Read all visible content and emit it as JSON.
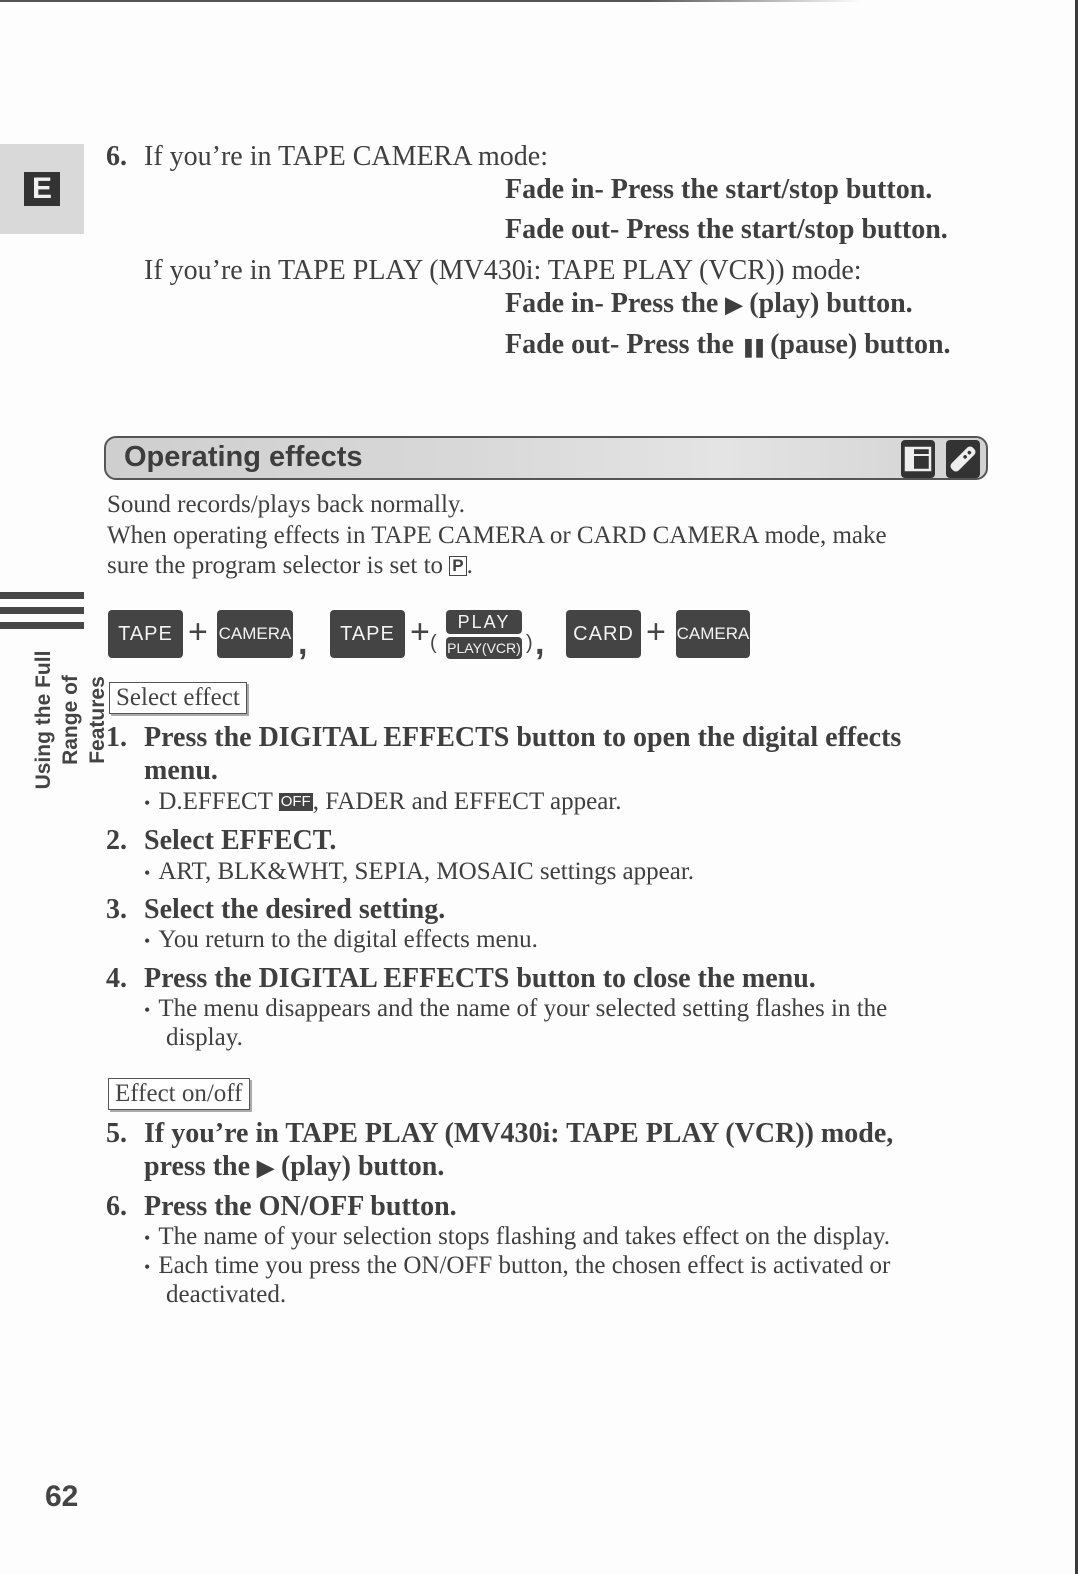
{
  "page": {
    "section_tab_letter": "E",
    "side_label_line1": "Using the Full",
    "side_label_line2": "Range of Features",
    "page_number": "62"
  },
  "intro_step": {
    "number": "6.",
    "tape_camera_line": "If you’re in TAPE CAMERA mode:",
    "tape_camera_fade_in": "Fade in- Press the start/stop button.",
    "tape_camera_fade_out": "Fade out- Press the start/stop button.",
    "tape_play_line": "If you’re in TAPE PLAY (MV430i: TAPE PLAY (VCR)) mode:",
    "tape_play_fade_in_pre": "Fade in- Press the",
    "tape_play_fade_in_post": "(play) button.",
    "tape_play_fade_out_pre": "Fade out- Press the",
    "tape_play_fade_out_post": "(pause) button.",
    "play_glyph": "▶",
    "pause_glyph": "❚❚"
  },
  "section": {
    "title": "Operating effects",
    "icons": [
      "card-icon",
      "remote-control-icon"
    ],
    "para1": "Sound records/plays back normally.",
    "para2": "When operating effects in TAPE CAMERA or CARD CAMERA mode, make",
    "para3_pre": "sure the program selector is set to",
    "para3_symbol": "P",
    "para3_post": "."
  },
  "mode_keys": {
    "group1": {
      "key1": "TAPE",
      "plus": "+",
      "key2": "CAMERA"
    },
    "comma": ",",
    "group2": {
      "key1": "TAPE",
      "plus": "+",
      "open_paren": "(",
      "key2_top": "PLAY",
      "key2_bottom": "PLAY(VCR)",
      "close_paren": ")"
    },
    "group3": {
      "key1": "CARD",
      "plus": "+",
      "key2": "CAMERA"
    }
  },
  "select_effect": {
    "label": "Select effect",
    "steps": [
      {
        "number": "1.",
        "line1": "Press the DIGITAL EFFECTS button to open the digital effects",
        "line2": "menu.",
        "bullet_pre": "D.EFFECT",
        "bullet_badge": "OFF",
        "bullet_post": ", FADER and EFFECT appear."
      },
      {
        "number": "2.",
        "line1": "Select EFFECT.",
        "bullet": "ART, BLK&WHT, SEPIA, MOSAIC settings appear."
      },
      {
        "number": "3.",
        "line1": "Select the desired setting.",
        "bullet": "You return to the digital effects menu."
      },
      {
        "number": "4.",
        "line1": "Press the DIGITAL EFFECTS button to close the menu.",
        "bullet_line1": "The menu disappears and the name of your selected setting flashes in the",
        "bullet_line2": "display."
      }
    ]
  },
  "effect_onoff": {
    "label": "Effect on/off",
    "steps": [
      {
        "number": "5.",
        "line1": "If you’re in TAPE PLAY (MV430i: TAPE PLAY (VCR)) mode,",
        "line2_pre": "press the",
        "line2_post": "(play) button."
      },
      {
        "number": "6.",
        "line1": "Press the ON/OFF button.",
        "bullet1": "The name of your selection stops flashing and takes effect on the display.",
        "bullet2_line1": "Each time you press the ON/OFF button, the chosen effect is activated or",
        "bullet2_line2": "deactivated."
      }
    ]
  },
  "bullet_glyph": "•"
}
